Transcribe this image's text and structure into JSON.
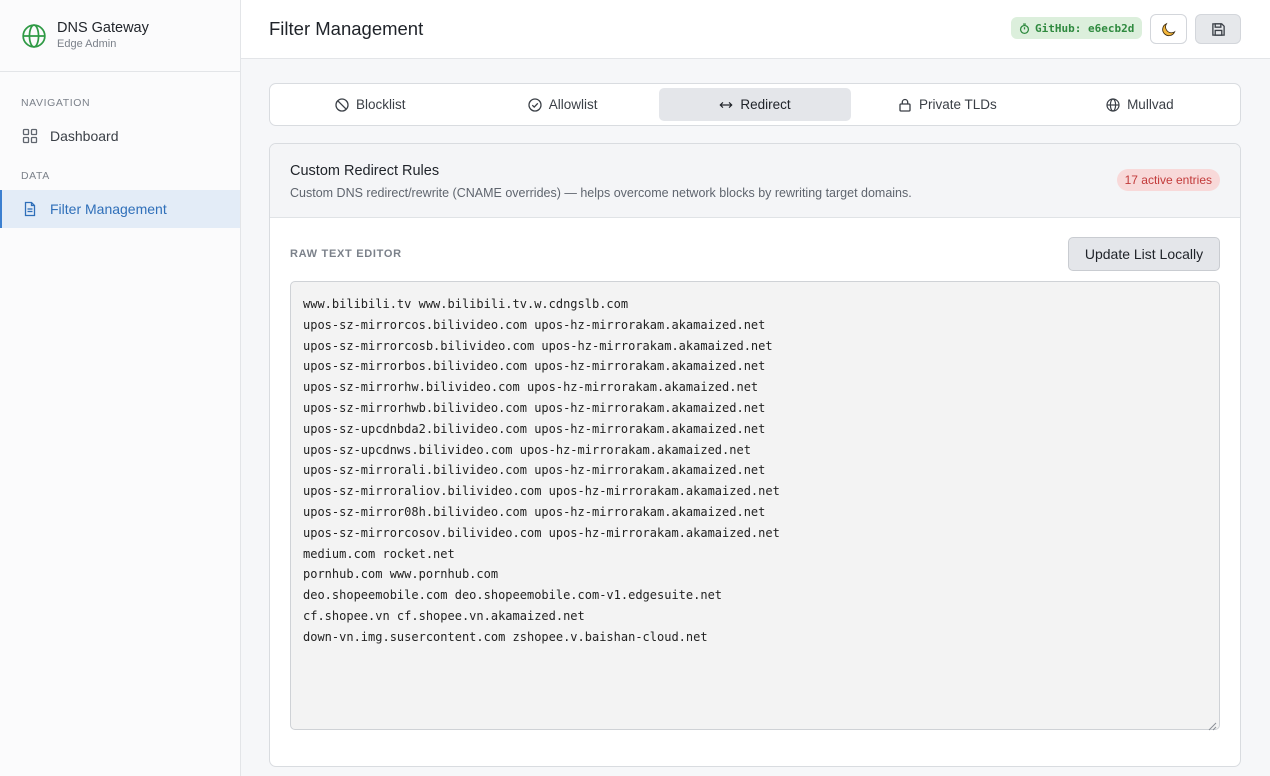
{
  "brand": {
    "title": "DNS Gateway",
    "subtitle": "Edge Admin",
    "logo_icon": "globe-icon",
    "accent": "#2f9a45"
  },
  "sidebar": {
    "sections": [
      {
        "label": "NAVIGATION",
        "items": [
          {
            "label": "Dashboard",
            "icon": "grid-icon"
          }
        ]
      },
      {
        "label": "DATA",
        "items": [
          {
            "label": "Filter Management",
            "icon": "document-icon",
            "active": true
          }
        ]
      }
    ]
  },
  "header": {
    "title": "Filter Management",
    "github_badge": "GitHub: e6ecb2d",
    "theme_icon": "moon-icon",
    "save_icon": "save-icon"
  },
  "tabs": [
    {
      "label": "Blocklist",
      "icon": "ban-icon"
    },
    {
      "label": "Allowlist",
      "icon": "check-circle-icon"
    },
    {
      "label": "Redirect",
      "icon": "arrows-horizontal-icon",
      "active": true
    },
    {
      "label": "Private TLDs",
      "icon": "lock-icon"
    },
    {
      "label": "Mullvad",
      "icon": "globe-icon"
    }
  ],
  "card": {
    "title": "Custom Redirect Rules",
    "description": "Custom DNS redirect/rewrite (CNAME overrides) — helps overcome network blocks by rewriting target domains.",
    "entries_badge": "17 active entries",
    "editor_label": "RAW TEXT EDITOR",
    "update_button": "Update List Locally",
    "lines": [
      "www.bilibili.tv www.bilibili.tv.w.cdngslb.com",
      "upos-sz-mirrorcos.bilivideo.com upos-hz-mirrorakam.akamaized.net",
      "upos-sz-mirrorcosb.bilivideo.com upos-hz-mirrorakam.akamaized.net",
      "upos-sz-mirrorbos.bilivideo.com upos-hz-mirrorakam.akamaized.net",
      "upos-sz-mirrorhw.bilivideo.com upos-hz-mirrorakam.akamaized.net",
      "upos-sz-mirrorhwb.bilivideo.com upos-hz-mirrorakam.akamaized.net",
      "upos-sz-upcdnbda2.bilivideo.com upos-hz-mirrorakam.akamaized.net",
      "upos-sz-upcdnws.bilivideo.com upos-hz-mirrorakam.akamaized.net",
      "upos-sz-mirrorali.bilivideo.com upos-hz-mirrorakam.akamaized.net",
      "upos-sz-mirroraliov.bilivideo.com upos-hz-mirrorakam.akamaized.net",
      "upos-sz-mirror08h.bilivideo.com upos-hz-mirrorakam.akamaized.net",
      "upos-sz-mirrorcosov.bilivideo.com upos-hz-mirrorakam.akamaized.net",
      "medium.com rocket.net",
      "pornhub.com www.pornhub.com",
      "deo.shopeemobile.com deo.shopeemobile.com-v1.edgesuite.net",
      "cf.shopee.vn cf.shopee.vn.akamaized.net",
      "down-vn.img.susercontent.com zshopee.v.baishan-cloud.net"
    ]
  }
}
